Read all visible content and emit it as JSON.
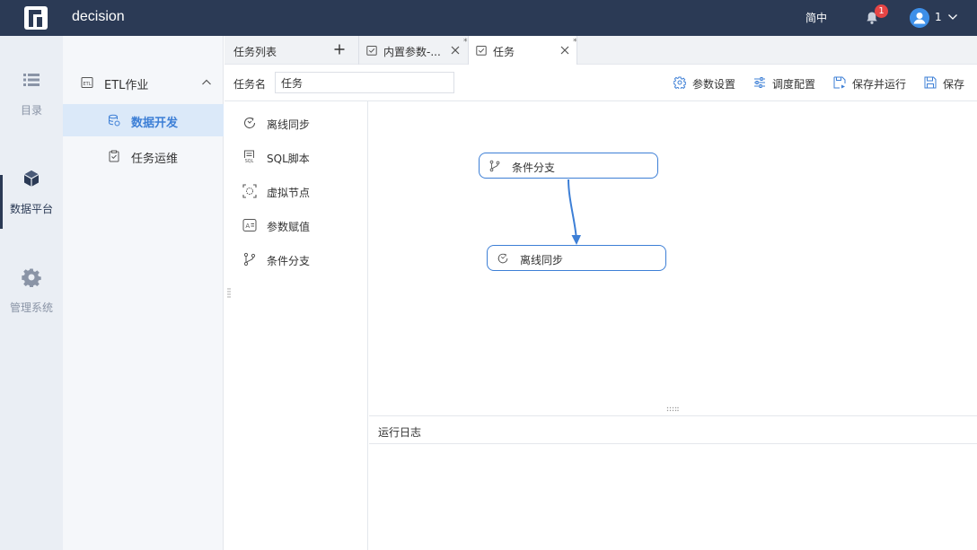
{
  "app": {
    "title": "decision",
    "language": "简中",
    "notification_count": "1",
    "user_name": "1"
  },
  "leftnav": {
    "items": [
      {
        "label": "目录",
        "icon": "list-icon"
      },
      {
        "label": "数据平台",
        "icon": "cube-icon",
        "active": true
      },
      {
        "label": "管理系统",
        "icon": "gear-icon"
      }
    ]
  },
  "subnav": {
    "group": {
      "label": "ETL作业",
      "icon": "etl-icon",
      "expanded": true
    },
    "items": [
      {
        "label": "数据开发",
        "icon": "database-icon",
        "active": true
      },
      {
        "label": "任务运维",
        "icon": "clipboard-icon"
      }
    ]
  },
  "tabs": {
    "list_label": "任务列表",
    "items": [
      {
        "label": "内置参数-...",
        "modified": "*"
      },
      {
        "label": "任务",
        "modified": "*",
        "active": true
      }
    ]
  },
  "toolbar": {
    "task_name_label": "任务名",
    "task_name_value": "任务",
    "buttons": [
      {
        "label": "参数设置",
        "icon": "settings-icon"
      },
      {
        "label": "调度配置",
        "icon": "sliders-icon"
      },
      {
        "label": "保存并运行",
        "icon": "save-run-icon"
      },
      {
        "label": "保存",
        "icon": "save-icon"
      }
    ]
  },
  "components": [
    {
      "label": "离线同步",
      "icon": "sync-icon"
    },
    {
      "label": "SQL脚本",
      "icon": "sql-icon"
    },
    {
      "label": "虚拟节点",
      "icon": "virtual-node-icon"
    },
    {
      "label": "参数赋值",
      "icon": "param-assign-icon"
    },
    {
      "label": "条件分支",
      "icon": "branch-icon"
    }
  ],
  "canvas": {
    "nodes": [
      {
        "label": "条件分支",
        "icon": "branch-icon"
      },
      {
        "label": "离线同步",
        "icon": "sync-icon"
      }
    ]
  },
  "log": {
    "title": "运行日志"
  },
  "colors": {
    "topbar": "#2b3a55",
    "accent": "#3d7fd6",
    "badge": "#e64545"
  }
}
